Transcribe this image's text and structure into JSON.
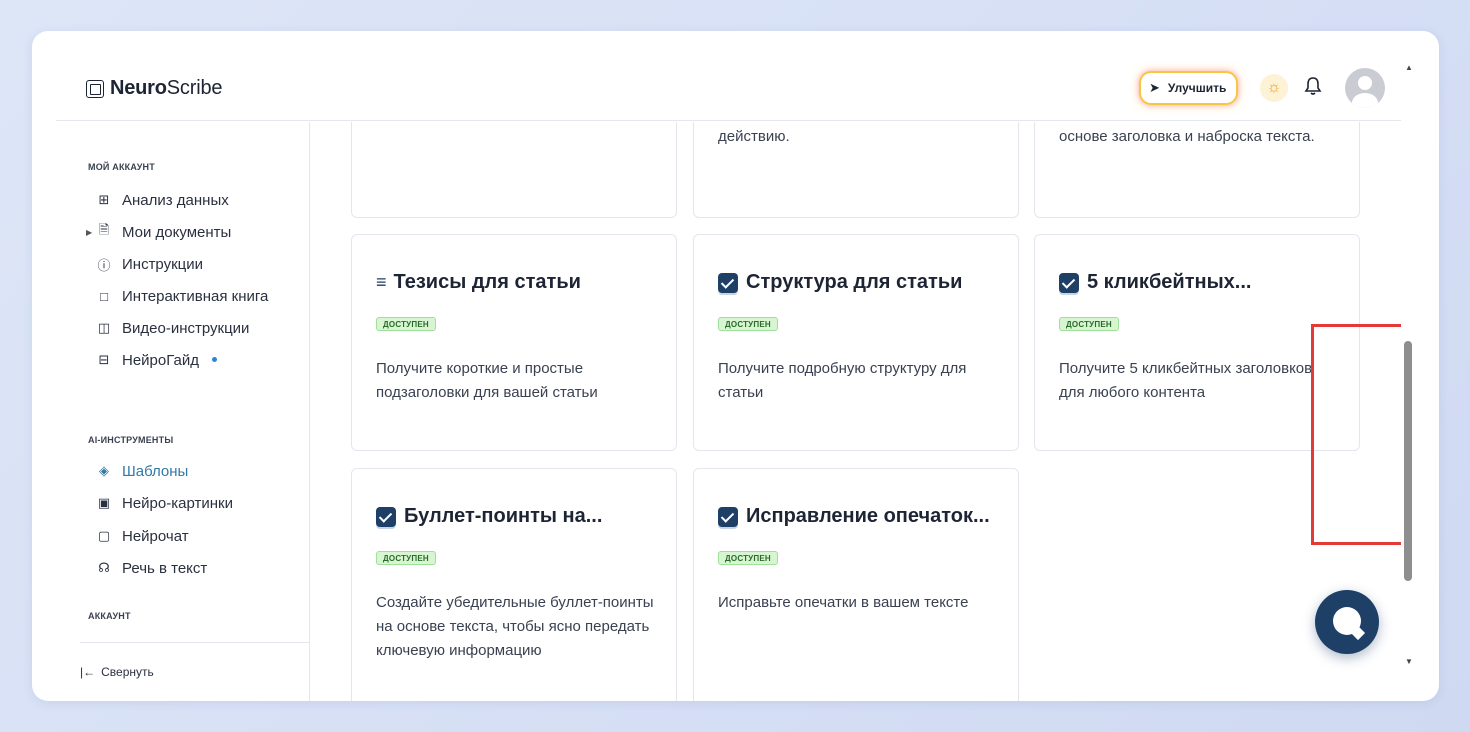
{
  "header": {
    "logo_bold": "Neuro",
    "logo_light": "Scribe",
    "upgrade_label": "Улучшить"
  },
  "sidebar": {
    "section_account": "МОЙ АККАУНТ",
    "account_items": [
      {
        "label": "Анализ данных",
        "icon": "grid-icon"
      },
      {
        "label": "Мои документы",
        "icon": "document-icon"
      },
      {
        "label": "Инструкции",
        "icon": "help-circle-icon"
      },
      {
        "label": "Интерактивная книга",
        "icon": "book-icon"
      },
      {
        "label": "Видео-инструкции",
        "icon": "video-icon"
      },
      {
        "label": "НейроГайд",
        "icon": "layout-icon"
      }
    ],
    "section_ai": "AI-ИНСТРУМЕНТЫ",
    "ai_items": [
      {
        "label": "Шаблоны",
        "icon": "layers-icon",
        "active": true
      },
      {
        "label": "Нейро-картинки",
        "icon": "image-icon"
      },
      {
        "label": "Нейрочат",
        "icon": "chat-icon"
      },
      {
        "label": "Речь в текст",
        "icon": "headphones-icon"
      }
    ],
    "section_account2": "АККАУНТ",
    "collapse_label": "Свернуть"
  },
  "cards_top": [
    {
      "desc": ""
    },
    {
      "desc": "действию."
    },
    {
      "desc": "основе заголовка и наброска текста."
    }
  ],
  "cards": [
    {
      "title": "Тезисы для статьи",
      "badge": "ДОСТУПЕН",
      "desc": "Получите короткие и простые подзаголовки для вашей статьи",
      "icon": "numbered-list-icon"
    },
    {
      "title": "Структура для статьи",
      "badge": "ДОСТУПЕН",
      "desc": "Получите подробную структуру для статьи",
      "icon": "checkbox-icon"
    },
    {
      "title": "5 кликбейтных...",
      "badge": "ДОСТУПЕН",
      "desc": "Получите 5 кликбейтных заголовков для любого контента",
      "icon": "checkbox-icon"
    },
    {
      "title": "Буллет-поинты на...",
      "badge": "ДОСТУПЕН",
      "desc": "Создайте убедительные буллет-поинты на основе текста, чтобы ясно передать ключевую информацию",
      "icon": "checkbox-icon"
    },
    {
      "title": "Исправление опечаток...",
      "badge": "ДОСТУПЕН",
      "desc": "Исправьте опечатки в вашем тексте",
      "icon": "checkbox-icon"
    }
  ],
  "colors": {
    "accent": "#2f7aa8",
    "navy": "#1e3f66",
    "badge_bg": "#d8f5d2",
    "highlight": "#e53935"
  }
}
